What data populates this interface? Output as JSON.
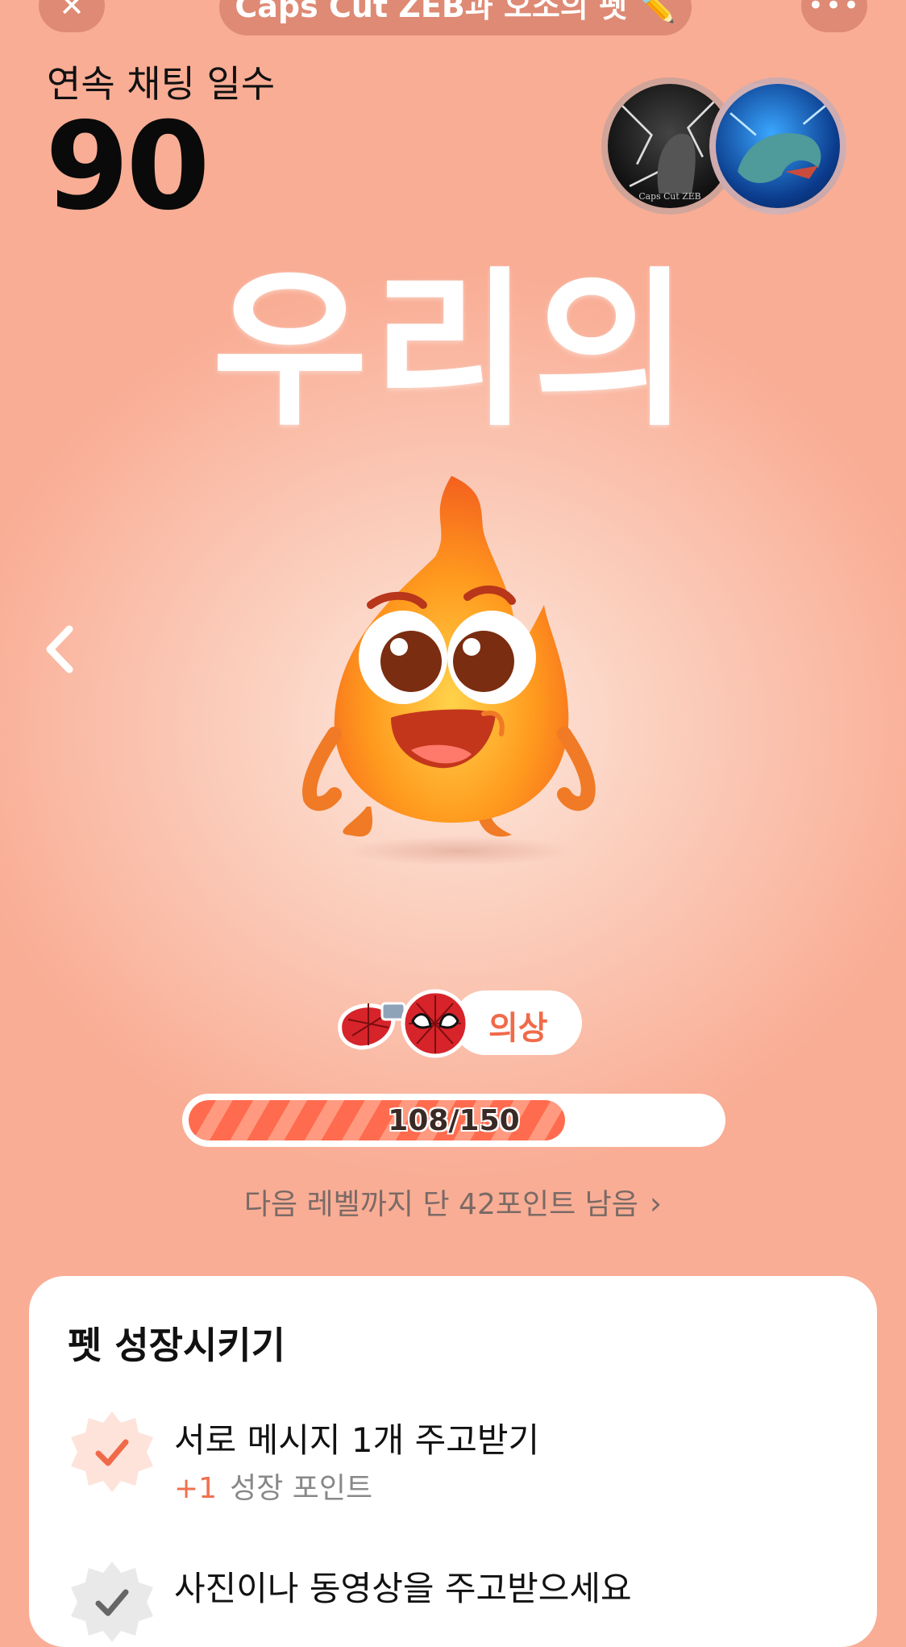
{
  "header": {
    "title": "Caps Cut ZEB과 오소의 펫 ✏️",
    "close_icon": "close-icon",
    "more_icon": "more-icon"
  },
  "streak": {
    "label": "연속 채팅 일수",
    "value": "90"
  },
  "pet": {
    "name_heading": "우리의",
    "costume_label": "의상"
  },
  "progress": {
    "current": 108,
    "max": 150,
    "text": "108/150",
    "fraction": 0.72
  },
  "next_level": {
    "text": "다음 레벨까지 단 42포인트 남음"
  },
  "card": {
    "title": "펫 성장시키기",
    "tasks": [
      {
        "title": "서로 메시지 1개 주고받기",
        "points": "+1",
        "points_label": "성장 포인트",
        "status": "completed"
      },
      {
        "title": "사진이나 동영상을 주고받으세요",
        "status": "completed"
      }
    ]
  },
  "colors": {
    "accent": "#f06a4a",
    "progress_fill": "#ff6b4e",
    "background_top": "#f9ad95",
    "background_center": "#fde8de"
  }
}
